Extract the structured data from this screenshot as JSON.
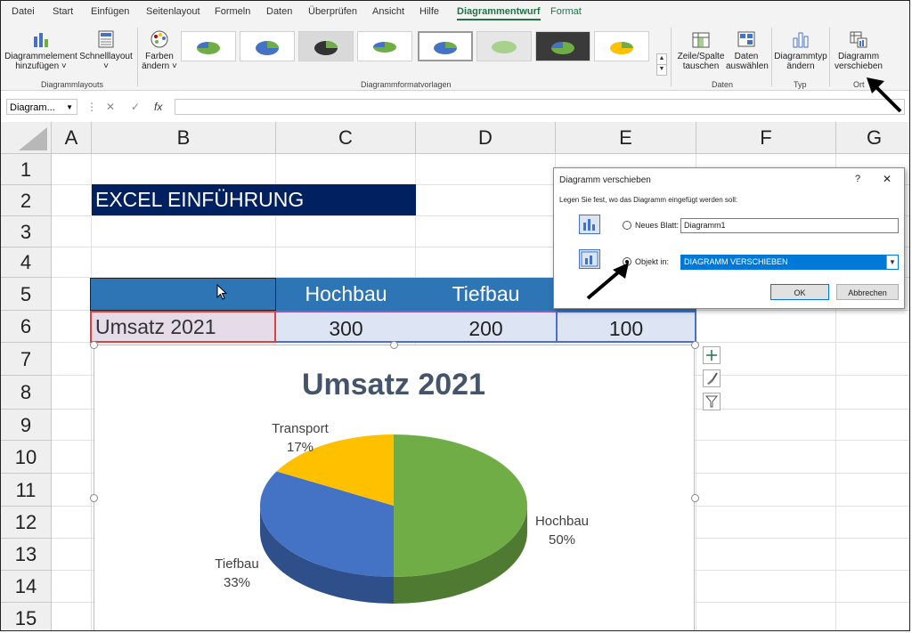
{
  "tabs": [
    "Datei",
    "Start",
    "Einfügen",
    "Seitenlayout",
    "Formeln",
    "Daten",
    "Überprüfen",
    "Ansicht",
    "Hilfe",
    "Diagrammentwurf",
    "Format"
  ],
  "ribbon": {
    "add_element": "Diagrammelement\nhinzufügen ˅",
    "quick_layout": "Schnelllayout\n˅",
    "colors": "Farben\nändern ˅",
    "switch_row_col": "Zeile/Spalte\ntauschen",
    "select_data": "Daten\nauswählen",
    "change_type": "Diagrammtyp\nändern",
    "move_chart": "Diagramm\nverschieben",
    "groups": {
      "layouts": "Diagrammlayouts",
      "styles": "Diagrammformatvorlagen",
      "data": "Daten",
      "type": "Typ",
      "location": "Ort"
    }
  },
  "formula_bar": {
    "name_box": "Diagram...",
    "fx": "fx"
  },
  "columns": [
    "A",
    "B",
    "C",
    "D",
    "E",
    "F",
    "G"
  ],
  "rows": [
    "1",
    "2",
    "3",
    "4",
    "5",
    "6",
    "7",
    "8",
    "9",
    "10",
    "11",
    "12",
    "13",
    "14",
    "15"
  ],
  "sheet": {
    "title": "EXCEL EINFÜHRUNG",
    "headers": [
      "Hochbau",
      "Tiefbau"
    ],
    "row_label": "Umsatz 2021",
    "values": [
      "300",
      "200",
      "100"
    ]
  },
  "colors": {
    "accent": "#217346",
    "title_bg": "#002060",
    "header_bg": "#2e75b6",
    "hochbau": "#70ad47",
    "tiefbau": "#4472c4",
    "transport": "#ffc000"
  },
  "chart_data": {
    "type": "pie",
    "title": "Umsatz 2021",
    "slices": [
      {
        "label": "Hochbau",
        "value": 50,
        "percent": "50%"
      },
      {
        "label": "Tiefbau",
        "value": 33,
        "percent": "33%"
      },
      {
        "label": "Transport",
        "value": 17,
        "percent": "17%"
      }
    ]
  },
  "dialog": {
    "title": "Diagramm verschieben",
    "help": "?",
    "close": "✕",
    "prompt": "Legen Sie fest, wo das Diagramm eingefügt werden soll:",
    "new_sheet_label": "Neues Blatt:",
    "new_sheet_value": "Diagramm1",
    "object_in_label": "Objekt in:",
    "object_in_value": "DIAGRAMM VERSCHIEBEN",
    "ok": "OK",
    "cancel": "Abbrechen"
  }
}
